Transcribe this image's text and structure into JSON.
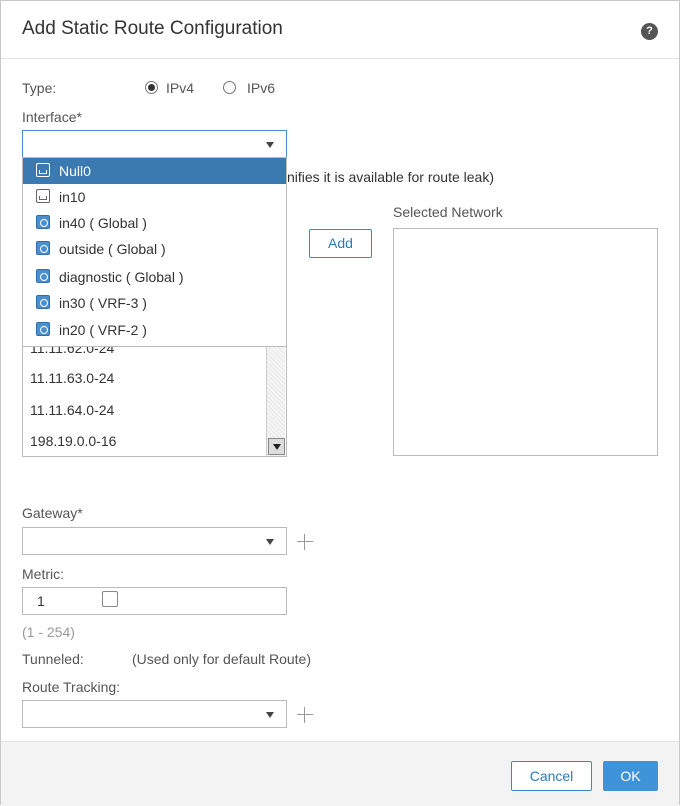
{
  "dialog": {
    "title": "Add Static Route Configuration",
    "help_glyph": "?"
  },
  "type_row": {
    "label": "Type:",
    "options": [
      {
        "label": "IPv4",
        "checked": true
      },
      {
        "label": "IPv6",
        "checked": false
      }
    ]
  },
  "interface": {
    "label": "Interface*",
    "value": "",
    "hint_partial": "nifies it is available for route leak)",
    "options": [
      {
        "label": "Null0",
        "icon": "interface-icon",
        "selected": true
      },
      {
        "label": "in10",
        "icon": "interface-icon",
        "selected": false
      },
      {
        "label": "in40 ( Global )",
        "icon": "global-interface-icon",
        "selected": false
      },
      {
        "label": "outside ( Global )",
        "icon": "global-interface-icon",
        "selected": false
      },
      {
        "label": "diagnostic ( Global )",
        "icon": "global-interface-icon",
        "selected": false
      },
      {
        "label": "in30 ( VRF-3 )",
        "icon": "global-interface-icon",
        "selected": false
      },
      {
        "label": "in20 ( VRF-2 )",
        "icon": "global-interface-icon",
        "selected": false
      }
    ]
  },
  "networks": {
    "available": [
      "11.11.62.0-24",
      "11.11.63.0-24",
      "11.11.64.0-24",
      "198.19.0.0-16"
    ],
    "add_label": "Add",
    "selected_label": "Selected Network"
  },
  "gateway": {
    "label": "Gateway*",
    "value": ""
  },
  "metric": {
    "label": "Metric:",
    "value": "1",
    "range_hint": "(1 - 254)"
  },
  "tunneled": {
    "label": "Tunneled:",
    "checked": false,
    "note": "(Used only for default Route)"
  },
  "route_tracking": {
    "label": "Route Tracking:",
    "value": ""
  },
  "footer": {
    "cancel_label": "Cancel",
    "ok_label": "OK"
  },
  "colors": {
    "accent": "#3f93d8",
    "selected_row": "#3a7ab0"
  }
}
